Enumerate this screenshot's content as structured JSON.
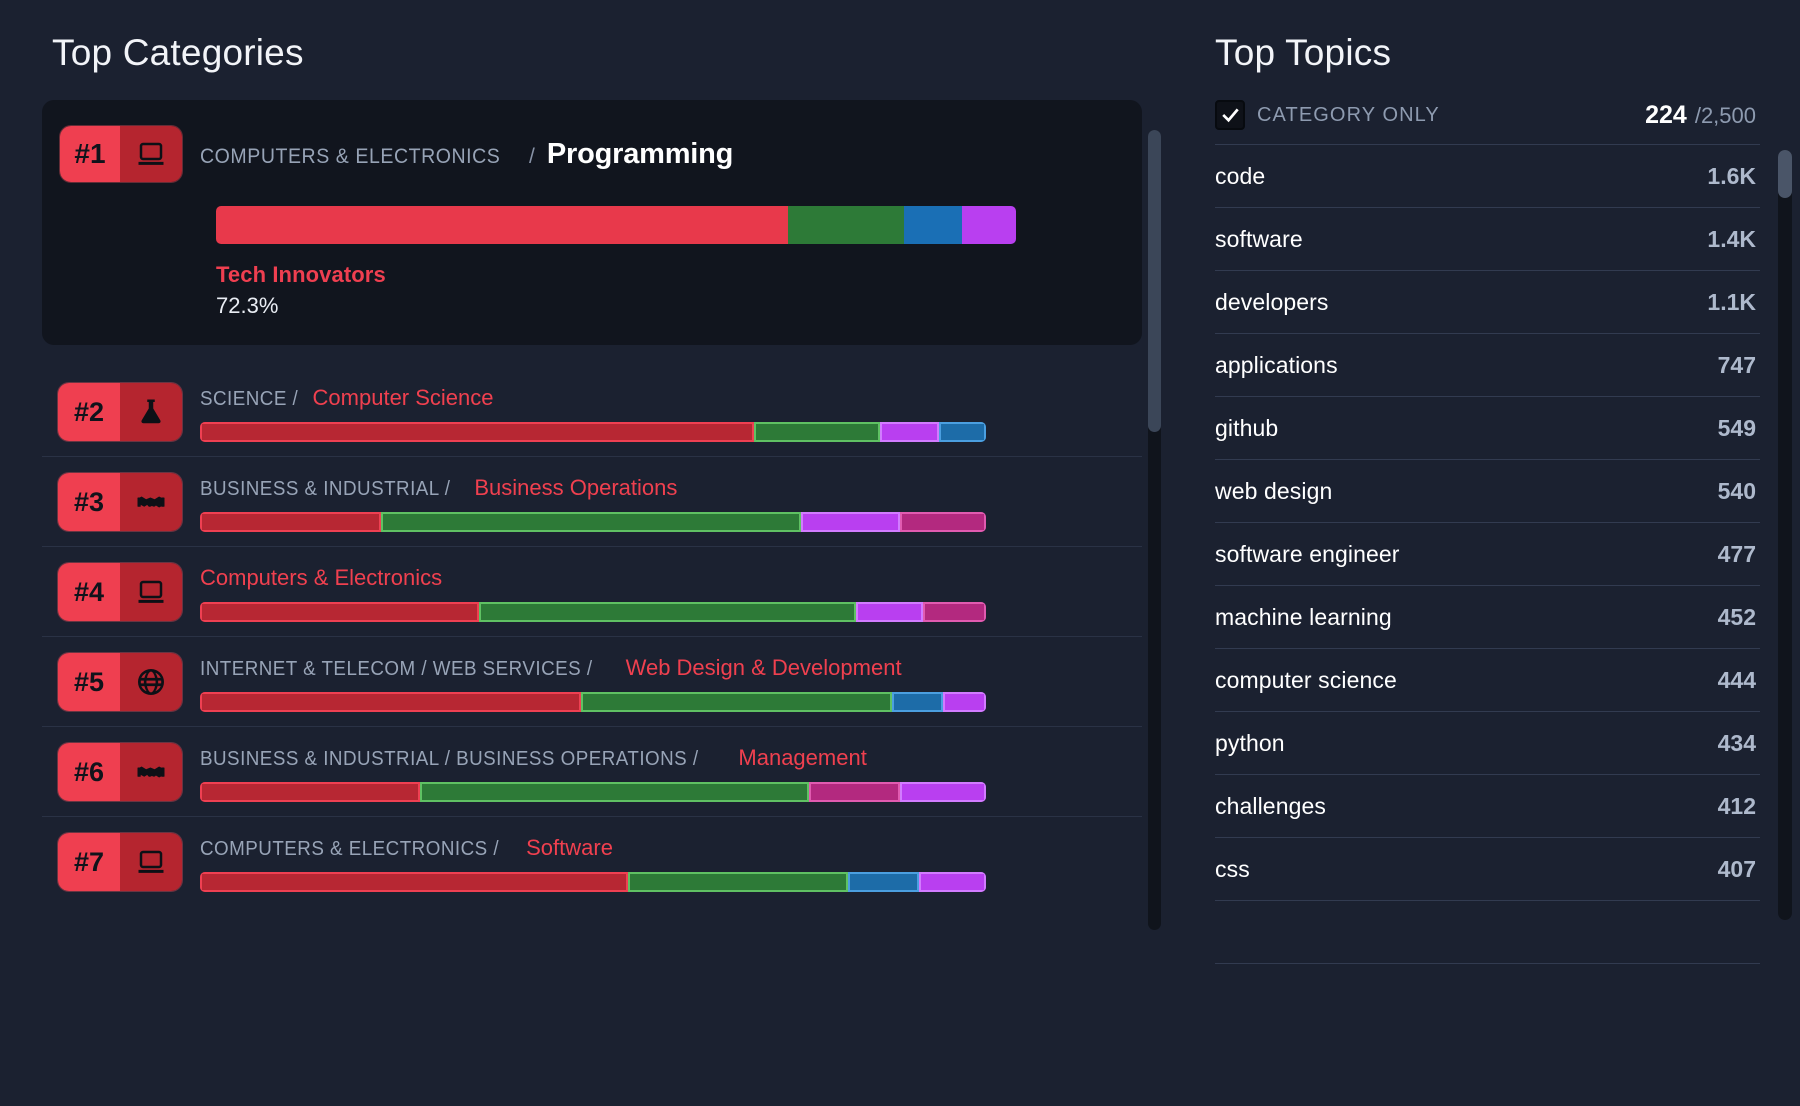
{
  "left": {
    "title": "Top Categories",
    "featured": {
      "rank": "#1",
      "icon": "laptop-icon",
      "crumb": "COMPUTERS & ELECTRONICS",
      "separator": "/",
      "leaf": "Programming",
      "brand": "Tech Innovators",
      "percent": "72.3%",
      "segments": [
        {
          "color": "#e8394b",
          "pct": 71.5
        },
        {
          "color": "#2d7a37",
          "pct": 14.5
        },
        {
          "color": "#1a6fb5",
          "pct": 7.3
        },
        {
          "color": "#b93ff0",
          "pct": 6.7
        }
      ]
    },
    "rows": [
      {
        "rank": "#2",
        "icon": "flask-icon",
        "crumb": "SCIENCE",
        "separator": "/",
        "leaf": "Computer Science",
        "segments": [
          {
            "color": "#b72733",
            "border": "#ef4052",
            "pct": 70.5
          },
          {
            "color": "#2d7a37",
            "border": "#5fc163",
            "pct": 16.0
          },
          {
            "color": "#b93ff0",
            "border": "#d27bff",
            "pct": 7.5
          },
          {
            "color": "#1d6ca8",
            "border": "#4b9fe0",
            "pct": 6.0
          }
        ]
      },
      {
        "rank": "#3",
        "icon": "handshake-icon",
        "crumb": "BUSINESS & INDUSTRIAL",
        "separator": "/",
        "leaf": "Business Operations",
        "segments": [
          {
            "color": "#b72733",
            "border": "#ef4052",
            "pct": 23.0
          },
          {
            "color": "#2d7a37",
            "border": "#5fc163",
            "pct": 53.5
          },
          {
            "color": "#b93ff0",
            "border": "#d27bff",
            "pct": 12.5
          },
          {
            "color": "#b3297f",
            "border": "#e15bb0",
            "pct": 11.0
          }
        ]
      },
      {
        "rank": "#4",
        "icon": "laptop-icon",
        "crumb": "",
        "separator": "",
        "leaf": "Computers & Electronics",
        "segments": [
          {
            "color": "#b72733",
            "border": "#ef4052",
            "pct": 35.5
          },
          {
            "color": "#2d7a37",
            "border": "#5fc163",
            "pct": 48.0
          },
          {
            "color": "#b93ff0",
            "border": "#d27bff",
            "pct": 8.5
          },
          {
            "color": "#b3297f",
            "border": "#e15bb0",
            "pct": 8.0
          }
        ]
      },
      {
        "rank": "#5",
        "icon": "globe-icon",
        "crumb": "INTERNET & TELECOM / WEB SERVICES",
        "separator": "/",
        "leaf": "Web Design & Development",
        "segments": [
          {
            "color": "#b72733",
            "border": "#ef4052",
            "pct": 48.5
          },
          {
            "color": "#2d7a37",
            "border": "#5fc163",
            "pct": 39.5
          },
          {
            "color": "#1d6ca8",
            "border": "#4b9fe0",
            "pct": 6.5
          },
          {
            "color": "#b93ff0",
            "border": "#d27bff",
            "pct": 5.5
          }
        ]
      },
      {
        "rank": "#6",
        "icon": "handshake-icon",
        "crumb": "BUSINESS & INDUSTRIAL / BUSINESS OPERATIONS",
        "separator": "/",
        "leaf": "Management",
        "segments": [
          {
            "color": "#b72733",
            "border": "#ef4052",
            "pct": 28.0
          },
          {
            "color": "#2d7a37",
            "border": "#5fc163",
            "pct": 49.5
          },
          {
            "color": "#b3297f",
            "border": "#e15bb0",
            "pct": 11.5
          },
          {
            "color": "#b93ff0",
            "border": "#d27bff",
            "pct": 11.0
          }
        ]
      },
      {
        "rank": "#7",
        "icon": "laptop-icon",
        "crumb": "COMPUTERS & ELECTRONICS",
        "separator": "/",
        "leaf": "Software",
        "segments": [
          {
            "color": "#b72733",
            "border": "#ef4052",
            "pct": 54.5
          },
          {
            "color": "#2d7a37",
            "border": "#5fc163",
            "pct": 28.0
          },
          {
            "color": "#1d6ca8",
            "border": "#4b9fe0",
            "pct": 9.0
          },
          {
            "color": "#b93ff0",
            "border": "#d27bff",
            "pct": 8.5
          }
        ]
      }
    ]
  },
  "right": {
    "title": "Top Topics",
    "filter_label": "CATEGORY ONLY",
    "filter_checked": true,
    "count_current": "224",
    "count_total": "/2,500",
    "topics": [
      {
        "name": "code",
        "value": "1.6K"
      },
      {
        "name": "software",
        "value": "1.4K"
      },
      {
        "name": "developers",
        "value": "1.1K"
      },
      {
        "name": "applications",
        "value": "747"
      },
      {
        "name": "github",
        "value": "549"
      },
      {
        "name": "web design",
        "value": "540"
      },
      {
        "name": "software engineer",
        "value": "477"
      },
      {
        "name": "machine learning",
        "value": "452"
      },
      {
        "name": "computer science",
        "value": "444"
      },
      {
        "name": "python",
        "value": "434"
      },
      {
        "name": "challenges",
        "value": "412"
      },
      {
        "name": "css",
        "value": "407"
      },
      {
        "name": "",
        "value": ""
      }
    ]
  },
  "colors": {
    "accent_red": "#ef3f50",
    "bar_red": "#e8394b",
    "bar_green": "#2d7a37",
    "bar_blue": "#1a6fb5",
    "bar_purple": "#b93ff0",
    "bar_magenta": "#b3297f",
    "background": "#1b2130",
    "card": "#11151e"
  }
}
